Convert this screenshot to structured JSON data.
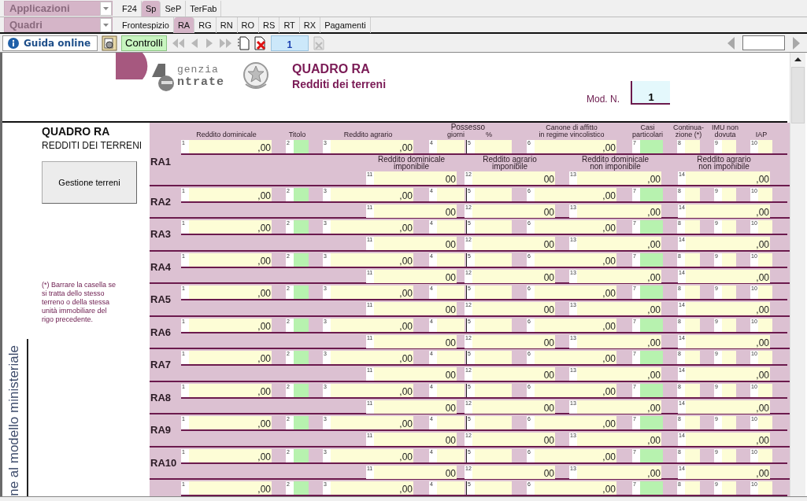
{
  "menu": {
    "applications": "Applicazioni",
    "sections": "Quadri"
  },
  "app_tabs": [
    {
      "label": "F24",
      "selected": false
    },
    {
      "label": "Sp",
      "selected": true
    },
    {
      "label": "SeP",
      "selected": false
    },
    {
      "label": "TerFab",
      "selected": false
    }
  ],
  "section_tabs": [
    {
      "label": "Frontespizio",
      "selected": false
    },
    {
      "label": "RA",
      "selected": true
    },
    {
      "label": "RG",
      "selected": false
    },
    {
      "label": "RN",
      "selected": false
    },
    {
      "label": "RO",
      "selected": false
    },
    {
      "label": "RS",
      "selected": false
    },
    {
      "label": "RT",
      "selected": false
    },
    {
      "label": "RX",
      "selected": false
    },
    {
      "label": "Pagamenti",
      "selected": false
    }
  ],
  "toolbar": {
    "help": "Guida online",
    "check": "Controlli",
    "page": "1"
  },
  "form": {
    "logo_text": [
      "genzia",
      "ntrate"
    ],
    "title": "QUADRO RA",
    "subtitle": "Redditi dei terreni",
    "mod_label": "Mod. N.",
    "mod_value": "1",
    "section_title": "QUADRO RA",
    "section_subtitle": "REDDITI DEI TERRENI",
    "manage_button": "Gestione terreni",
    "note": "(*) Barrare la casella se si tratta dello stesso terreno o della stessa unità immobiliare del rigo precedente.",
    "side_caption": "ne al modello ministeriale",
    "possesso": "Possesso",
    "headers": [
      "Reddito dominicale",
      "Titolo",
      "Reddito agrario",
      "giorni",
      "%",
      "Canone di affitto\nin regime vincolistico",
      "Casi\nparticolari",
      "Continua-\nzione (*)",
      "IMU non\ndovuta",
      "IAP"
    ],
    "rows": [
      {
        "label": "RA1",
        "subheaders": [
          "Reddito dominicale\nimponibile",
          "Reddito agrario\nimponibile",
          "Reddito dominicale\nnon imponibile",
          "Reddito agrario\nnon imponibile"
        ],
        "top": [
          {
            "n": "1",
            "kind": "box",
            "v": ",00"
          },
          {
            "n": "2",
            "kind": "code"
          },
          {
            "n": "3",
            "kind": "box",
            "v": ",00"
          },
          {
            "n": "4",
            "kind": "box"
          },
          {
            "n": "5",
            "kind": "box"
          },
          {
            "n": "6",
            "kind": "box",
            "v": ",00"
          },
          {
            "n": "7",
            "kind": "code"
          },
          {
            "n": "8",
            "kind": "box"
          },
          {
            "n": "9",
            "kind": "box"
          },
          {
            "n": "10",
            "kind": "box"
          }
        ],
        "bottom": [
          {
            "n": "11",
            "kind": "box",
            "v": "00"
          },
          {
            "n": "12",
            "kind": "box",
            "v": "00"
          },
          {
            "n": "13",
            "kind": "box",
            "v": ",00"
          },
          {
            "n": "14",
            "kind": "box",
            "v": ",00"
          }
        ]
      },
      {
        "label": "RA2",
        "top": [
          {
            "n": "1",
            "kind": "box",
            "v": ",00"
          },
          {
            "n": "2",
            "kind": "code"
          },
          {
            "n": "3",
            "kind": "box",
            "v": ",00"
          },
          {
            "n": "4",
            "kind": "box"
          },
          {
            "n": "5",
            "kind": "box"
          },
          {
            "n": "6",
            "kind": "box",
            "v": ",00"
          },
          {
            "n": "7",
            "kind": "code"
          },
          {
            "n": "8",
            "kind": "box"
          },
          {
            "n": "9",
            "kind": "box"
          },
          {
            "n": "10",
            "kind": "box"
          }
        ],
        "bottom": [
          {
            "n": "11",
            "kind": "box",
            "v": "00"
          },
          {
            "n": "12",
            "kind": "box",
            "v": "00"
          },
          {
            "n": "13",
            "kind": "box",
            "v": ",00"
          },
          {
            "n": "14",
            "kind": "box",
            "v": ",00"
          }
        ]
      },
      {
        "label": "RA3",
        "top": [
          {
            "n": "1",
            "kind": "box",
            "v": ",00"
          },
          {
            "n": "2",
            "kind": "code"
          },
          {
            "n": "3",
            "kind": "box",
            "v": ",00"
          },
          {
            "n": "4",
            "kind": "box"
          },
          {
            "n": "5",
            "kind": "box"
          },
          {
            "n": "6",
            "kind": "box",
            "v": ",00"
          },
          {
            "n": "7",
            "kind": "code"
          },
          {
            "n": "8",
            "kind": "box"
          },
          {
            "n": "9",
            "kind": "box"
          },
          {
            "n": "10",
            "kind": "box"
          }
        ],
        "bottom": [
          {
            "n": "11",
            "kind": "box",
            "v": "00"
          },
          {
            "n": "12",
            "kind": "box",
            "v": "00"
          },
          {
            "n": "13",
            "kind": "box",
            "v": ",00"
          },
          {
            "n": "14",
            "kind": "box",
            "v": ",00"
          }
        ]
      },
      {
        "label": "RA4",
        "top": [
          {
            "n": "1",
            "kind": "box",
            "v": ",00"
          },
          {
            "n": "2",
            "kind": "code"
          },
          {
            "n": "3",
            "kind": "box",
            "v": ",00"
          },
          {
            "n": "4",
            "kind": "box"
          },
          {
            "n": "5",
            "kind": "box"
          },
          {
            "n": "6",
            "kind": "box",
            "v": ",00"
          },
          {
            "n": "7",
            "kind": "code"
          },
          {
            "n": "8",
            "kind": "box"
          },
          {
            "n": "9",
            "kind": "box"
          },
          {
            "n": "10",
            "kind": "box"
          }
        ],
        "bottom": [
          {
            "n": "11",
            "kind": "box",
            "v": "00"
          },
          {
            "n": "12",
            "kind": "box",
            "v": "00"
          },
          {
            "n": "13",
            "kind": "box",
            "v": ",00"
          },
          {
            "n": "14",
            "kind": "box",
            "v": ",00"
          }
        ]
      },
      {
        "label": "RA5",
        "top": [
          {
            "n": "1",
            "kind": "box",
            "v": ",00"
          },
          {
            "n": "2",
            "kind": "code"
          },
          {
            "n": "3",
            "kind": "box",
            "v": ",00"
          },
          {
            "n": "4",
            "kind": "box"
          },
          {
            "n": "5",
            "kind": "box"
          },
          {
            "n": "6",
            "kind": "box",
            "v": ",00"
          },
          {
            "n": "7",
            "kind": "code"
          },
          {
            "n": "8",
            "kind": "box"
          },
          {
            "n": "9",
            "kind": "box"
          },
          {
            "n": "10",
            "kind": "box"
          }
        ],
        "bottom": [
          {
            "n": "11",
            "kind": "box",
            "v": "00"
          },
          {
            "n": "12",
            "kind": "box",
            "v": "00"
          },
          {
            "n": "13",
            "kind": "box",
            "v": ",00"
          },
          {
            "n": "14",
            "kind": "box",
            "v": ",00"
          }
        ]
      },
      {
        "label": "RA6",
        "top": [
          {
            "n": "1",
            "kind": "box",
            "v": ",00"
          },
          {
            "n": "2",
            "kind": "code"
          },
          {
            "n": "3",
            "kind": "box",
            "v": ",00"
          },
          {
            "n": "4",
            "kind": "box"
          },
          {
            "n": "5",
            "kind": "box"
          },
          {
            "n": "6",
            "kind": "box",
            "v": ",00"
          },
          {
            "n": "7",
            "kind": "code"
          },
          {
            "n": "8",
            "kind": "box"
          },
          {
            "n": "9",
            "kind": "box"
          },
          {
            "n": "10",
            "kind": "box"
          }
        ],
        "bottom": [
          {
            "n": "11",
            "kind": "box",
            "v": "00"
          },
          {
            "n": "12",
            "kind": "box",
            "v": "00"
          },
          {
            "n": "13",
            "kind": "box",
            "v": ",00"
          },
          {
            "n": "14",
            "kind": "box",
            "v": ",00"
          }
        ]
      },
      {
        "label": "RA7",
        "top": [
          {
            "n": "1",
            "kind": "box",
            "v": ",00"
          },
          {
            "n": "2",
            "kind": "code"
          },
          {
            "n": "3",
            "kind": "box",
            "v": ",00"
          },
          {
            "n": "4",
            "kind": "box"
          },
          {
            "n": "5",
            "kind": "box"
          },
          {
            "n": "6",
            "kind": "box",
            "v": ",00"
          },
          {
            "n": "7",
            "kind": "code"
          },
          {
            "n": "8",
            "kind": "box"
          },
          {
            "n": "9",
            "kind": "box"
          },
          {
            "n": "10",
            "kind": "box"
          }
        ],
        "bottom": [
          {
            "n": "11",
            "kind": "box",
            "v": "00"
          },
          {
            "n": "12",
            "kind": "box",
            "v": "00"
          },
          {
            "n": "13",
            "kind": "box",
            "v": ",00"
          },
          {
            "n": "14",
            "kind": "box",
            "v": ",00"
          }
        ]
      },
      {
        "label": "RA8",
        "top": [
          {
            "n": "1",
            "kind": "box",
            "v": ",00"
          },
          {
            "n": "2",
            "kind": "code"
          },
          {
            "n": "3",
            "kind": "box",
            "v": ",00"
          },
          {
            "n": "4",
            "kind": "box"
          },
          {
            "n": "5",
            "kind": "box"
          },
          {
            "n": "6",
            "kind": "box",
            "v": ",00"
          },
          {
            "n": "7",
            "kind": "code"
          },
          {
            "n": "8",
            "kind": "box"
          },
          {
            "n": "9",
            "kind": "box"
          },
          {
            "n": "10",
            "kind": "box"
          }
        ],
        "bottom": [
          {
            "n": "11",
            "kind": "box",
            "v": "00"
          },
          {
            "n": "12",
            "kind": "box",
            "v": "00"
          },
          {
            "n": "13",
            "kind": "box",
            "v": ",00"
          },
          {
            "n": "14",
            "kind": "box",
            "v": ",00"
          }
        ]
      },
      {
        "label": "RA9",
        "top": [
          {
            "n": "1",
            "kind": "box",
            "v": ",00"
          },
          {
            "n": "2",
            "kind": "code"
          },
          {
            "n": "3",
            "kind": "box",
            "v": ",00"
          },
          {
            "n": "4",
            "kind": "box"
          },
          {
            "n": "5",
            "kind": "box"
          },
          {
            "n": "6",
            "kind": "box",
            "v": ",00"
          },
          {
            "n": "7",
            "kind": "code"
          },
          {
            "n": "8",
            "kind": "box"
          },
          {
            "n": "9",
            "kind": "box"
          },
          {
            "n": "10",
            "kind": "box"
          }
        ],
        "bottom": [
          {
            "n": "11",
            "kind": "box",
            "v": "00"
          },
          {
            "n": "12",
            "kind": "box",
            "v": "00"
          },
          {
            "n": "13",
            "kind": "box",
            "v": ",00"
          },
          {
            "n": "14",
            "kind": "box",
            "v": ",00"
          }
        ]
      },
      {
        "label": "RA10",
        "top": [
          {
            "n": "1",
            "kind": "box",
            "v": ",00"
          },
          {
            "n": "2",
            "kind": "code"
          },
          {
            "n": "3",
            "kind": "box",
            "v": ",00"
          },
          {
            "n": "4",
            "kind": "box"
          },
          {
            "n": "5",
            "kind": "box"
          },
          {
            "n": "6",
            "kind": "box",
            "v": ",00"
          },
          {
            "n": "7",
            "kind": "code"
          },
          {
            "n": "8",
            "kind": "box"
          },
          {
            "n": "9",
            "kind": "box"
          },
          {
            "n": "10",
            "kind": "box"
          }
        ],
        "bottom": [
          {
            "n": "11",
            "kind": "box",
            "v": "00"
          },
          {
            "n": "12",
            "kind": "box",
            "v": "00"
          },
          {
            "n": "13",
            "kind": "box",
            "v": ",00"
          },
          {
            "n": "14",
            "kind": "box",
            "v": ",00"
          }
        ]
      },
      {
        "top": [
          {
            "n": "1",
            "kind": "box",
            "v": ",00"
          },
          {
            "n": "2",
            "kind": "code"
          },
          {
            "n": "3",
            "kind": "box",
            "v": ",00"
          },
          {
            "n": "4",
            "kind": "box"
          },
          {
            "n": "5",
            "kind": "box"
          },
          {
            "n": "6",
            "kind": "box",
            "v": ",00"
          },
          {
            "n": "7",
            "kind": "code"
          },
          {
            "n": "8",
            "kind": "box"
          },
          {
            "n": "9",
            "kind": "box"
          },
          {
            "n": "10",
            "kind": "box"
          }
        ]
      }
    ]
  }
}
